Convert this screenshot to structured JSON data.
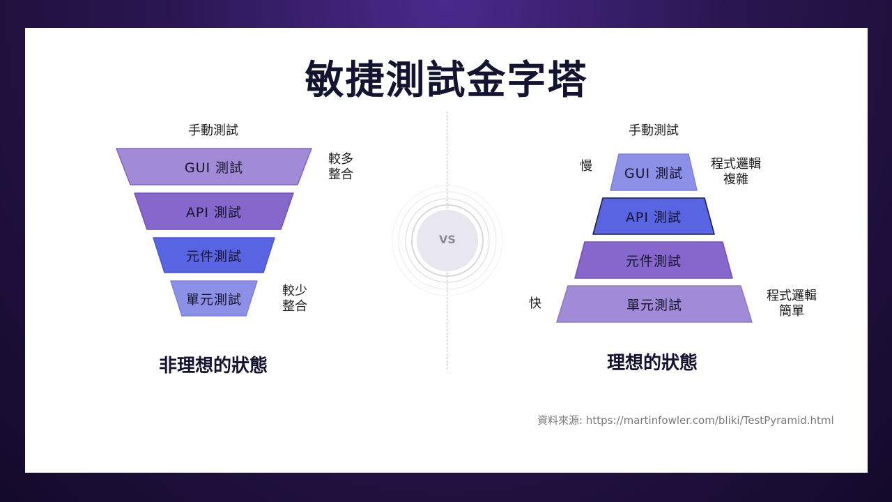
{
  "title": "敏捷測試金字塔",
  "left": {
    "top_label": "手動測試",
    "layers": [
      "GUI 測試",
      "API 測試",
      "元件測試",
      "單元測試"
    ],
    "note_top": [
      "較多",
      "整合"
    ],
    "note_bottom": [
      "較少",
      "整合"
    ],
    "state": "非理想的狀態"
  },
  "vs": "VS",
  "right": {
    "top_label": "手動測試",
    "layers": [
      "GUI 測試",
      "API 測試",
      "元件測試",
      "單元測試"
    ],
    "slow": "慢",
    "fast": "快",
    "note_top": [
      "程式邏輯",
      "複雜"
    ],
    "note_bottom": [
      "程式邏輯",
      "簡單"
    ],
    "state": "理想的狀態"
  },
  "source": "資料來源: https://martinfowler.com/bliki/TestPyramid.html",
  "colors": {
    "layer_light": "#a08ad6",
    "layer_mid": "#8768cc",
    "layer_blue": "#5864e2",
    "layer_pale": "#8b8fe6"
  }
}
